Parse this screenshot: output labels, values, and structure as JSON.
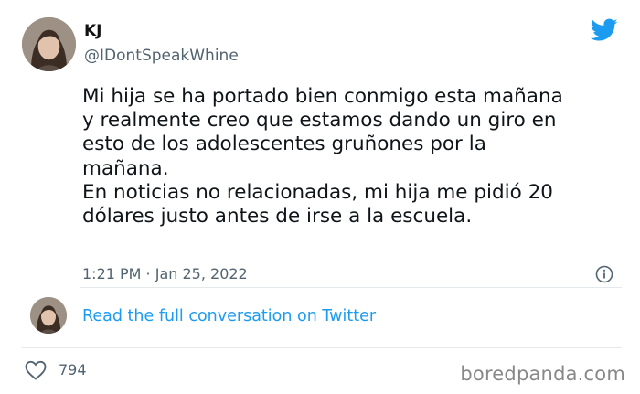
{
  "user": {
    "name": "KJ",
    "handle": "@IDontSpeakWhine"
  },
  "tweet": {
    "text": "Mi hija se ha portado bien conmigo esta mañana\ny realmente creo que estamos dando un giro en\nesto de los adolescentes gruñones por la\nmañana.\nEn noticias no relacionadas, mi hija me pidió 20\ndólares justo antes de irse a la escuela.",
    "timestamp": "1:21 PM · Jan 25, 2022"
  },
  "conversation": {
    "link_label": "Read the full conversation on Twitter"
  },
  "engagement": {
    "likes": "794"
  },
  "watermark": "boredpanda.com",
  "colors": {
    "link": "#1d9bf0",
    "muted": "#536471",
    "twitter_brand": "#1d9bf0"
  },
  "icons": [
    "twitter-bird-icon",
    "info-icon",
    "heart-icon"
  ]
}
